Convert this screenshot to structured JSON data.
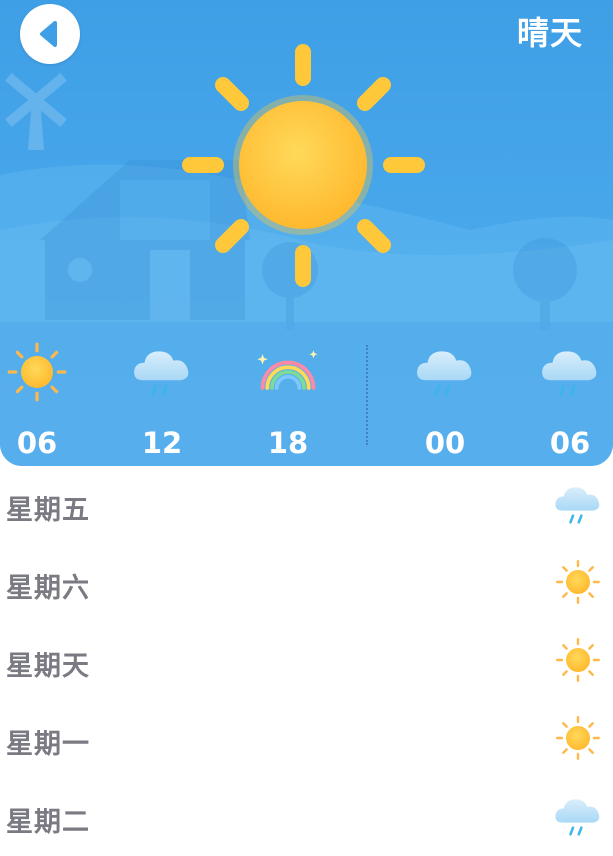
{
  "header": {
    "title": "晴天"
  },
  "icons": {
    "back": "back-arrow-icon",
    "main": "sun-icon"
  },
  "colors": {
    "sky": "#3f9fe6",
    "sun": "#ffc83a",
    "day_text": "#7a7a82",
    "rain": "#3db4ee"
  },
  "hourly": [
    {
      "time": "06",
      "icon": "sun-icon"
    },
    {
      "time": "12",
      "icon": "rain-cloud-icon"
    },
    {
      "time": "18",
      "icon": "rainbow-icon"
    },
    {
      "time": "00",
      "icon": "rain-cloud-icon"
    },
    {
      "time": "06",
      "icon": "rain-cloud-icon"
    }
  ],
  "daily": [
    {
      "day": "星期五",
      "icon": "rain-cloud-icon"
    },
    {
      "day": "星期六",
      "icon": "sun-icon"
    },
    {
      "day": "星期天",
      "icon": "sun-icon"
    },
    {
      "day": "星期一",
      "icon": "sun-icon"
    },
    {
      "day": "星期二",
      "icon": "rain-cloud-icon"
    }
  ]
}
